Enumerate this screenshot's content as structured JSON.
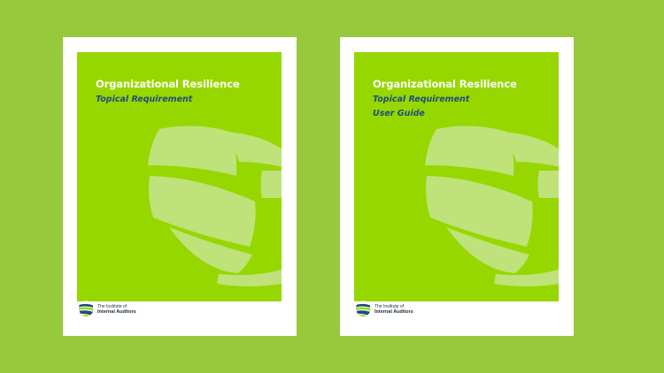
{
  "colors": {
    "background": "#97c93d",
    "paper": "#ffffff",
    "cover": "#97d700",
    "globe": "#bfe27a",
    "title": "#ffffff",
    "subtitle": "#1d4f7c",
    "logo_blue": "#1d4f7c",
    "logo_green": "#97d700"
  },
  "documents": [
    {
      "title": "Organizational Resilience",
      "subtitle_lines": [
        "Topical Requirement"
      ],
      "graphic": "globe-icon",
      "logo": {
        "icon": "iia-logo-icon",
        "line1": "The Institute of",
        "line2": "Internal Auditors"
      }
    },
    {
      "title": "Organizational Resilience",
      "subtitle_lines": [
        "Topical Requirement",
        "User Guide"
      ],
      "graphic": "globe-icon",
      "logo": {
        "icon": "iia-logo-icon",
        "line1": "The Institute of",
        "line2": "Internal Auditors"
      }
    }
  ]
}
